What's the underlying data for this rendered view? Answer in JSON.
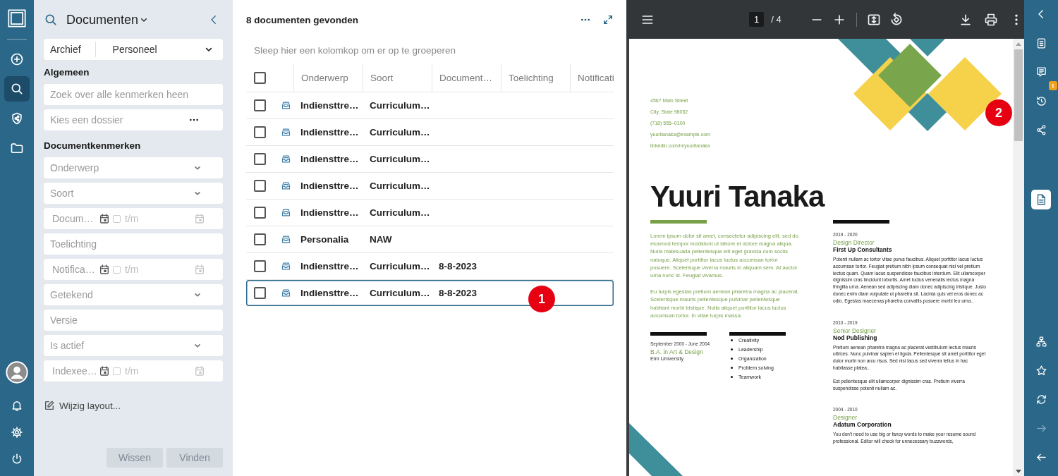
{
  "nav_rail": {
    "top": [
      {
        "kind": "add",
        "selected": false
      },
      {
        "kind": "search",
        "selected": true
      },
      {
        "kind": "shield",
        "selected": false
      },
      {
        "kind": "folder",
        "selected": false
      }
    ],
    "bottom": [
      {
        "kind": "avatar"
      },
      {
        "kind": "bell"
      },
      {
        "kind": "settings"
      },
      {
        "kind": "power"
      }
    ]
  },
  "filters": {
    "title": "Documenten",
    "archive": {
      "label": "Archief",
      "value": "Personeel"
    },
    "sections": [
      {
        "heading": "Algemeen",
        "fields": [
          {
            "kind": "text",
            "placeholder": "Zoek over alle kenmerken heen"
          },
          {
            "kind": "lookup",
            "placeholder": "Kies een dossier"
          }
        ]
      },
      {
        "heading": "Documentkenmerken",
        "fields": [
          {
            "kind": "select",
            "placeholder": "Onderwerp"
          },
          {
            "kind": "select",
            "placeholder": "Soort"
          },
          {
            "kind": "daterange",
            "label": "Docum…",
            "to_label": "t/m",
            "checked": false
          },
          {
            "kind": "text",
            "placeholder": "Toelichting"
          },
          {
            "kind": "daterange",
            "label": "Notifica…",
            "to_label": "t/m",
            "checked": false
          },
          {
            "kind": "select",
            "placeholder": "Getekend"
          },
          {
            "kind": "text",
            "placeholder": "Versie"
          },
          {
            "kind": "select",
            "placeholder": "Is actief"
          },
          {
            "kind": "daterange",
            "label": "Indexee…",
            "to_label": "t/m",
            "checked": false
          }
        ]
      }
    ],
    "edit_layout": "Wijzig layout...",
    "buttons": [
      {
        "label": "Wissen",
        "disabled": true
      },
      {
        "label": "Vinden",
        "disabled": true
      }
    ]
  },
  "results": {
    "title": "8 documenten gevonden",
    "group_hint": "Sleep hier een kolomkop om er op te groeperen",
    "table": {
      "select_all_checked": false,
      "columns": [
        "Onderwerp",
        "Soort",
        "Document…",
        "Toelichting",
        "Notificati"
      ],
      "rows": [
        {
          "checked": false,
          "selected": false,
          "onderwerp": "Indiensttre…",
          "soort": "Curriculum…"
        },
        {
          "checked": false,
          "selected": false,
          "onderwerp": "Indiensttre…",
          "soort": "Curriculum…"
        },
        {
          "checked": false,
          "selected": false,
          "onderwerp": "Indiensttre…",
          "soort": "Curriculum…"
        },
        {
          "checked": false,
          "selected": false,
          "onderwerp": "Indiensttre…",
          "soort": "Curriculum…"
        },
        {
          "checked": false,
          "selected": false,
          "onderwerp": "Indiensttre…",
          "soort": "Curriculum…"
        },
        {
          "checked": false,
          "selected": false,
          "onderwerp": "Personalia",
          "soort": "NAW"
        },
        {
          "checked": false,
          "selected": false,
          "onderwerp": "Indiensttre…",
          "soort": "Curriculum…",
          "document": "8-8-2023"
        },
        {
          "checked": false,
          "selected": true,
          "onderwerp": "Indiensttre…",
          "soort": "Curriculum…",
          "document": "8-8-2023"
        }
      ]
    }
  },
  "viewer": {
    "page": "1",
    "page_count": "/ 4",
    "resume": {
      "contact": [
        "4567 Main Street",
        "City, State 98052",
        "(718) 555–0100",
        "yuuritanaka@example.com",
        "linkedin.com/in/yuuritanaka"
      ],
      "name": "Yuuri Tanaka",
      "summary": [
        "Lorem ipsum dolor sit amet, consectetur adipiscing elit, sed do eiusmod tempor incididunt ut labore et dolore magna aliqua. Nulla malesuada pellentesque elit eget gravida cum sociis natoque. Aliquet porttitor lacus luctus accumsan tortor posuere. Scelerisque viverra mauris in aliquam sem. At auctor urna nunc id. Feugiat vivamus.",
        "Eu turpis egestas pretium aenean pharetra magna ac placerat. Scelerisque mauris pellentesque pulvinar pellentesque habitant morbi tristique. Nulla aliquet porttitor lacus luctus accumsan tortor. In vitae turpis massa."
      ],
      "education": {
        "dates": "September 2000 - June 2004",
        "degree": "B.A. in Art & Design",
        "school": "Elm University"
      },
      "skills": [
        "Creativity",
        "Leadership",
        "Organization",
        "Problem solving",
        "Teamwork"
      ],
      "experience": [
        {
          "years": "2019 - 2020",
          "title": "Design Director",
          "company": "First Up Consultants",
          "paragraphs": [
            "Potenti nullam ac tortor vitae purus faucibus. Aliquet porttitor lacus luctus accumsan tortor. Feugiat pretium nibh ipsum consequat nisl vel pretium lectus quam. Quam lacus suspendisse faucibus interdum. Elit ullamcorper dignissim cras tincidunt lobortis. Amet luctus venenatis lectus magna fringilla urna. Aenean sed adipiscing diam donec adipiscing tristique. Justo donec enim diam vulputate ut pharetra sit. Lacinia quis vel eros donec ac odio. Egestas maecenas pharetra convallis posuere morbi leo urna.."
          ]
        },
        {
          "years": "2010 - 2019",
          "title": "Senior Designer",
          "company": "Nod Publishing",
          "paragraphs": [
            "Pretium aenean pharetra magna ac placerat vestibulum lectus mauris ultrices. Nunc pulvinar sapien et ligula. Pellentesque sit amet porttitor eget dolor morbi non arcu risus. Sed nisi lacus sed viverra tellus in hac habitasse platea..",
            "Est pellentesque elit ullamcorper dignissim cras. Pretium viverra suspendisse potenti nullam ac."
          ]
        },
        {
          "years": "2004 - 2010",
          "title": "Designer",
          "company": "Adatum Corporation",
          "paragraphs": [
            "You don't need to use big or fancy words to make your resume sound professional. Editor will check for unnecessary buzzwords,"
          ]
        }
      ]
    }
  },
  "side_rail": {
    "top": [
      {
        "kind": "details",
        "selected": false
      },
      {
        "kind": "comments",
        "selected": false,
        "badge": "1"
      },
      {
        "kind": "history",
        "selected": false
      },
      {
        "kind": "share",
        "selected": false
      },
      {
        "kind": "document",
        "selected": true
      }
    ],
    "bottom": [
      {
        "kind": "structure",
        "disabled": false
      },
      {
        "kind": "favorite",
        "disabled": false
      },
      {
        "kind": "sync",
        "disabled": false
      },
      {
        "kind": "forward",
        "disabled": true
      },
      {
        "kind": "back",
        "disabled": false
      }
    ]
  },
  "annotations": [
    {
      "label": "1"
    },
    {
      "label": "2"
    }
  ]
}
